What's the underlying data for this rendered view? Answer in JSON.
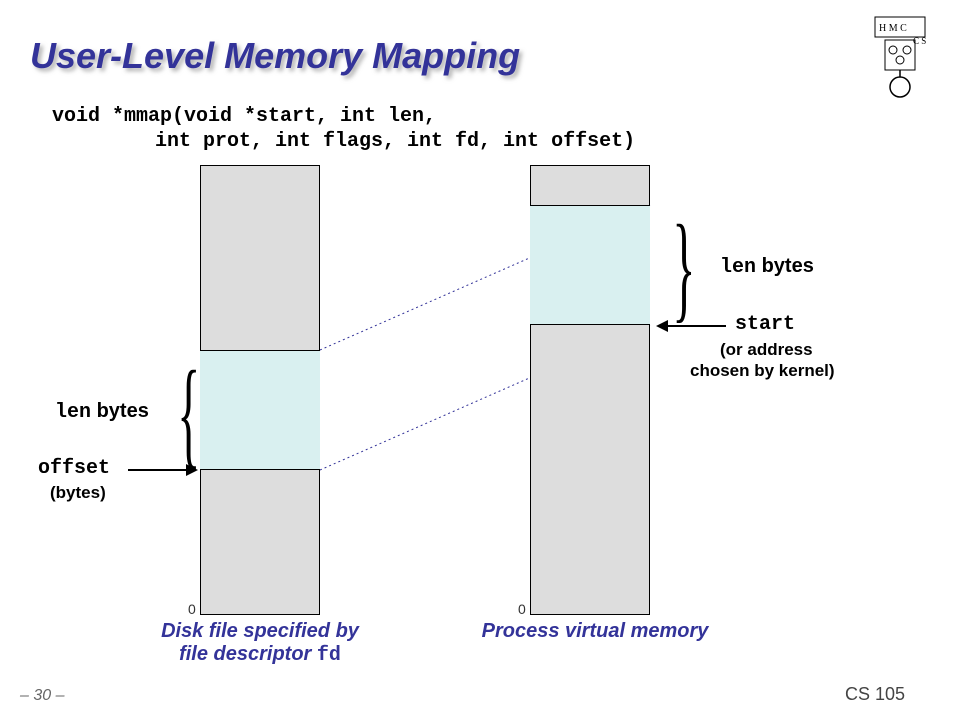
{
  "title": "User-Level Memory Mapping",
  "code": {
    "line1": "void *mmap(void *start, int len,",
    "line2": "int prot, int flags, int fd, int offset)"
  },
  "labels": {
    "len_bytes_left_mono": "len",
    "len_bytes_left_text": " bytes",
    "len_bytes_right_mono": "len",
    "len_bytes_right_text": " bytes",
    "offset_mono": "offset",
    "offset_sub": "(bytes)",
    "start_mono": "start",
    "start_sub1": "(or address",
    "start_sub2": "chosen by kernel)",
    "zero_left": "0",
    "zero_right": "0"
  },
  "captions": {
    "left1": "Disk file specified by",
    "left2_pre": "file descriptor ",
    "left2_mono": "fd",
    "right": "Process virtual memory"
  },
  "footer": {
    "page": "– 30 –",
    "course": "CS 105"
  }
}
